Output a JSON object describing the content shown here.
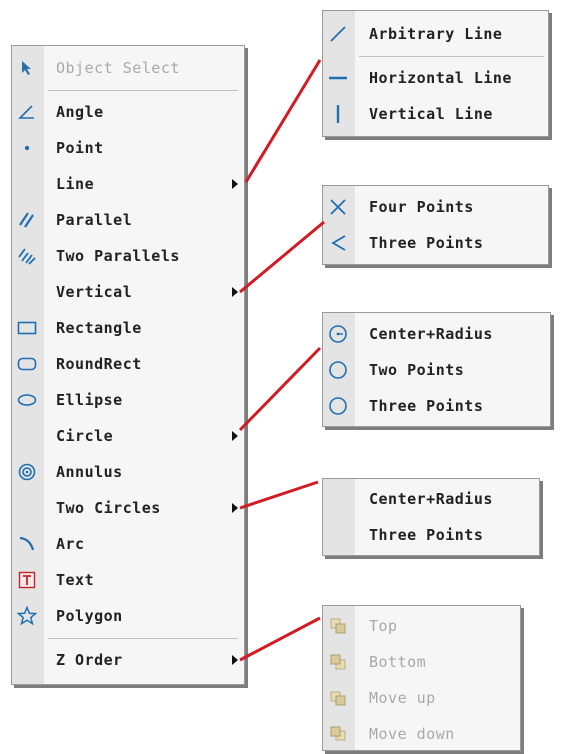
{
  "main_menu": {
    "items": [
      {
        "label": "Object Select",
        "icon": "cursor-icon",
        "disabled": true
      },
      {
        "label": "Angle",
        "icon": "angle-icon"
      },
      {
        "label": "Point",
        "icon": "point-icon"
      },
      {
        "label": "Line",
        "icon": "",
        "submenu": true
      },
      {
        "label": "Parallel",
        "icon": "parallel-icon"
      },
      {
        "label": "Two Parallels",
        "icon": "two-parallels-icon"
      },
      {
        "label": "Vertical",
        "icon": "",
        "submenu": true
      },
      {
        "label": "Rectangle",
        "icon": "rectangle-icon"
      },
      {
        "label": "RoundRect",
        "icon": "roundrect-icon"
      },
      {
        "label": "Ellipse",
        "icon": "ellipse-icon"
      },
      {
        "label": "Circle",
        "icon": "",
        "submenu": true
      },
      {
        "label": "Annulus",
        "icon": "annulus-icon"
      },
      {
        "label": "Two Circles",
        "icon": "",
        "submenu": true
      },
      {
        "label": "Arc",
        "icon": "arc-icon"
      },
      {
        "label": "Text",
        "icon": "text-icon"
      },
      {
        "label": "Polygon",
        "icon": "star-icon"
      },
      {
        "label": "Z Order",
        "icon": "",
        "submenu": true
      }
    ]
  },
  "submenus": {
    "line": [
      {
        "label": "Arbitrary Line",
        "icon": "arbitrary-line-icon"
      },
      {
        "label": "Horizontal Line",
        "icon": "horizontal-line-icon"
      },
      {
        "label": "Vertical Line",
        "icon": "vertical-line-icon"
      }
    ],
    "vertical": [
      {
        "label": "Four Points",
        "icon": "cross-icon"
      },
      {
        "label": "Three Points",
        "icon": "chevron-left-icon"
      }
    ],
    "circle": [
      {
        "label": "Center+Radius",
        "icon": "circle-center-icon"
      },
      {
        "label": "Two Points",
        "icon": "circle-icon"
      },
      {
        "label": "Three Points",
        "icon": "circle-icon"
      }
    ],
    "two_circles": [
      {
        "label": "Center+Radius"
      },
      {
        "label": "Three Points"
      }
    ],
    "z_order": [
      {
        "label": "Top",
        "icon": "layer-top-icon",
        "disabled": true
      },
      {
        "label": "Bottom",
        "icon": "layer-bottom-icon",
        "disabled": true
      },
      {
        "label": "Move up",
        "icon": "layer-up-icon",
        "disabled": true
      },
      {
        "label": "Move down",
        "icon": "layer-down-icon",
        "disabled": true
      }
    ]
  },
  "colors": {
    "icon_blue": "#1f6fb2",
    "connector_red": "#d21c24",
    "disabled_text": "#a9a9a9",
    "gutter": "#e4e4e4"
  }
}
